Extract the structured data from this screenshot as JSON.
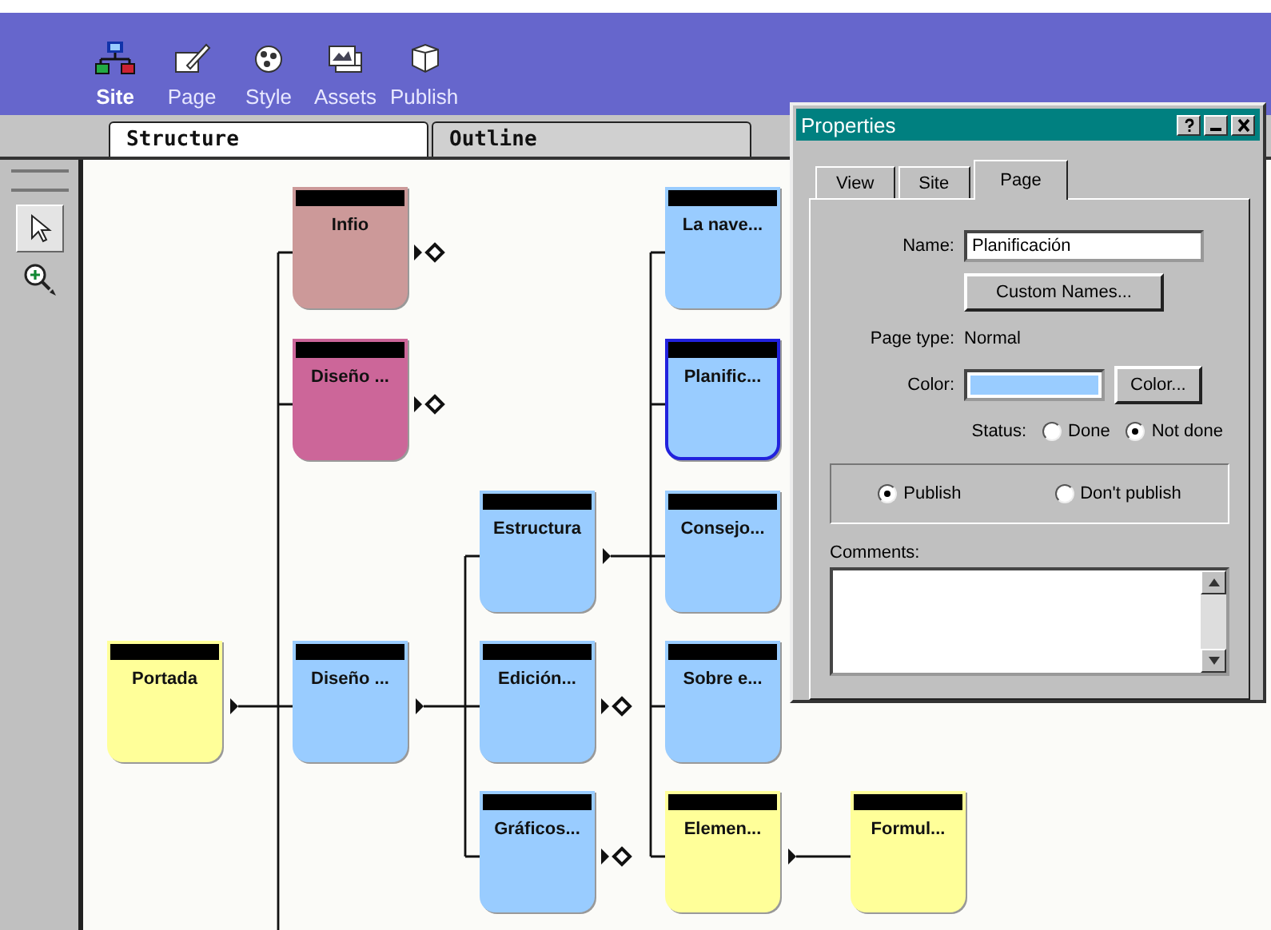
{
  "toolbar": [
    {
      "label": "Site",
      "selected": true
    },
    {
      "label": "Page",
      "selected": false
    },
    {
      "label": "Style",
      "selected": false
    },
    {
      "label": "Assets",
      "selected": false
    },
    {
      "label": "Publish",
      "selected": false
    }
  ],
  "view_tabs": [
    {
      "label": "Structure",
      "selected": true
    },
    {
      "label": "Outline",
      "selected": false
    }
  ],
  "tools": [
    {
      "kind": "pointer",
      "selected": true
    },
    {
      "kind": "zoom",
      "selected": false
    }
  ],
  "site_map": {
    "label": "Portada",
    "color": "#ffff99",
    "selected": false,
    "children": [
      {
        "label": "Infio",
        "color": "#cc9999",
        "selected": false,
        "collapsed": true
      },
      {
        "label": "Diseño ...",
        "color": "#cc6699",
        "selected": false,
        "collapsed": true
      },
      {
        "label": "Diseño ...",
        "color": "#99ccff",
        "selected": false,
        "children": [
          {
            "label": "Estructura",
            "color": "#99ccff",
            "selected": false,
            "children": [
              {
                "label": "La nave...",
                "color": "#99ccff",
                "selected": false
              },
              {
                "label": "Planific...",
                "color": "#99ccff",
                "selected": true
              },
              {
                "label": "Consejo...",
                "color": "#99ccff",
                "selected": false
              },
              {
                "label": "Sobre e...",
                "color": "#99ccff",
                "selected": false
              },
              {
                "label": "Elemen...",
                "color": "#ffff99",
                "selected": false,
                "children": [
                  {
                    "label": "Formul...",
                    "color": "#ffff99",
                    "selected": false
                  }
                ]
              }
            ]
          },
          {
            "label": "Edición...",
            "color": "#99ccff",
            "selected": false,
            "collapsed": true
          },
          {
            "label": "Gráficos...",
            "color": "#99ccff",
            "selected": false,
            "collapsed": true
          }
        ]
      }
    ]
  },
  "properties": {
    "title": "Properties",
    "tabs": [
      {
        "label": "View",
        "selected": false
      },
      {
        "label": "Site",
        "selected": false
      },
      {
        "label": "Page",
        "selected": true
      }
    ],
    "name_label": "Name:",
    "name_value": "Planificación",
    "custom_names_button": "Custom Names...",
    "page_type_label": "Page type:",
    "page_type_value": "Normal",
    "color_label": "Color:",
    "color_button": "Color...",
    "status_label": "Status:",
    "status_options": [
      {
        "label": "Done",
        "selected": false
      },
      {
        "label": "Not done",
        "selected": true
      }
    ],
    "publish_options": [
      {
        "label": "Publish",
        "selected": true
      },
      {
        "label": "Don't publish",
        "selected": false
      }
    ],
    "comments_label": "Comments:"
  }
}
